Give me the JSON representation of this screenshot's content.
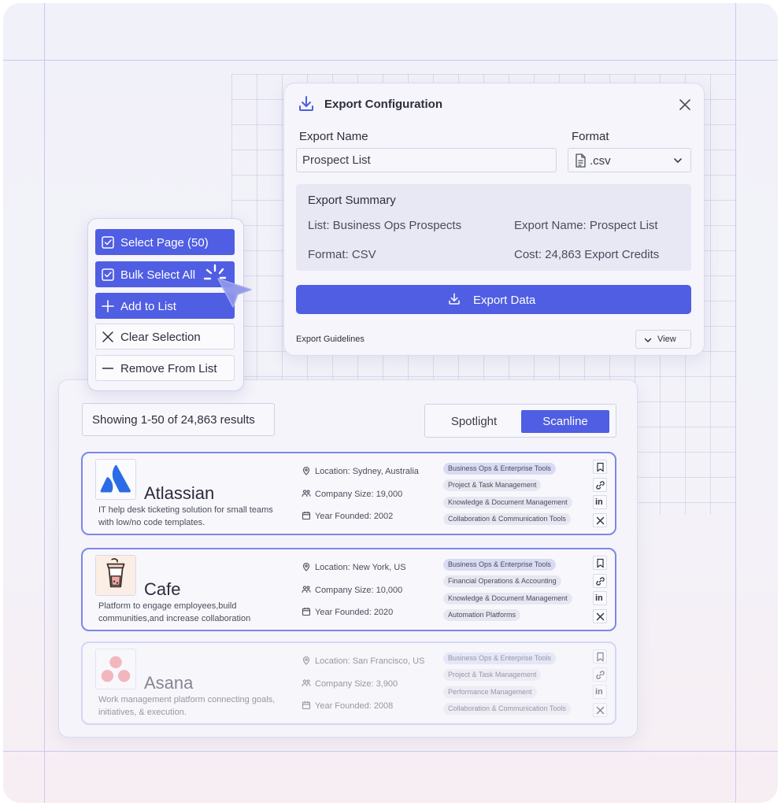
{
  "dialog": {
    "title": "Export Configuration",
    "export_name_label": "Export Name",
    "export_name_value": "Prospect List",
    "format_label": "Format",
    "format_value": ".csv",
    "summary": {
      "title": "Export Summary",
      "list": "List: Business Ops Prospects",
      "export_name": "Export Name: Prospect List",
      "format": "Format: CSV",
      "cost": "Cost: 24,863 Export Credits"
    },
    "export_button": "Export Data",
    "guidelines_label": "Export Guidelines",
    "view_button": "View"
  },
  "menu": {
    "select_page": "Select Page (50)",
    "bulk_select_all": "Bulk Select All",
    "add_to_list": "Add to List",
    "clear_selection": "Clear Selection",
    "remove_from_list": "Remove From List"
  },
  "results": {
    "showing": "Showing 1-50 of 24,863 results",
    "toggle": {
      "spotlight": "Spotlight",
      "scanline": "Scanline",
      "active": "Scanline"
    },
    "companies": [
      {
        "name": "Atlassian",
        "description": "IT help desk ticketing solution for small teams with low/no code templates.",
        "location": "Location: Sydney, Australia",
        "size": "Company Size: 19,000",
        "founded": "Year Founded: 2002",
        "tags": [
          "Business Ops & Enterprise Tools",
          "Project & Task Management",
          "Knowledge & Document Management",
          "Collaboration & Communication Tools"
        ]
      },
      {
        "name": "Cafe",
        "description": "Platform to engage employees,build communities,and increase collaboration",
        "location": "Location: New York, US",
        "size": "Company Size: 10,000",
        "founded": "Year Founded: 2020",
        "tags": [
          "Business Ops & Enterprise Tools",
          "Financial Operations & Accounting",
          "Knowledge & Document Management",
          "Automation Platforms"
        ]
      },
      {
        "name": "Asana",
        "description": "Work management platform connecting goals, initiatives, & execution.",
        "location": "Location: San Francisco, US",
        "size": "Company Size: 3,900",
        "founded": "Year Founded: 2008",
        "tags": [
          "Business Ops & Enterprise Tools",
          "Project & Task Management",
          "Performance Management",
          "Collaboration & Communication Tools"
        ]
      }
    ],
    "action_icons": [
      "bookmark-icon",
      "link-icon",
      "linkedin-icon",
      "x-icon"
    ],
    "linkedin_glyph": "in"
  },
  "colors": {
    "accent": "#4f5ee2",
    "card_border": "#7c86e8",
    "atlassian_blue": "#2b6ce6",
    "asana_coral": "#f0878a"
  }
}
